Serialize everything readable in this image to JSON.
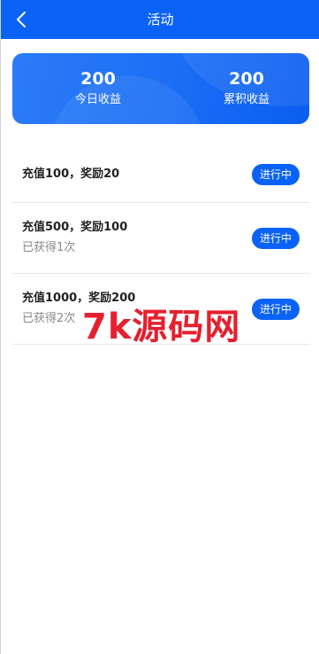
{
  "header": {
    "title": "活动",
    "back_icon": "chevron-left-icon"
  },
  "summary": {
    "today_value": "200",
    "today_label": "今日收益",
    "total_value": "200",
    "total_label": "累积收益"
  },
  "activities": [
    {
      "title": "充值100，奖励20",
      "subtitle": "",
      "status": "进行中"
    },
    {
      "title": "充值500，奖励100",
      "subtitle": "已获得1次",
      "status": "进行中"
    },
    {
      "title": "充值1000，奖励200",
      "subtitle": "已获得2次",
      "status": "进行中"
    }
  ],
  "watermark": "7k源码网",
  "colors": {
    "primary": "#0a63f6",
    "watermark": "#e5202e",
    "muted_text": "#8a8a8a"
  }
}
